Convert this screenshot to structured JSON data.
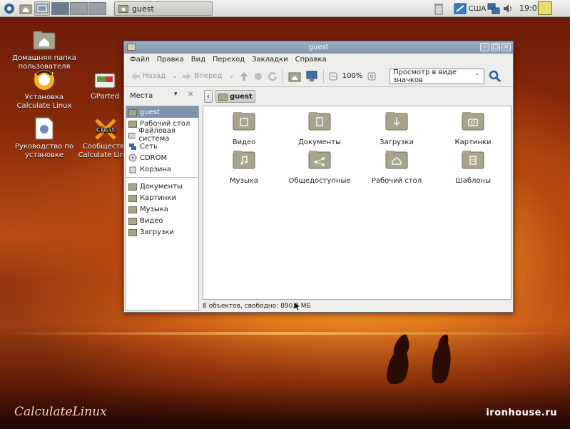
{
  "panel": {
    "task_title": "guest",
    "keyboard_layout": "США",
    "clock": "19:02"
  },
  "desktop": {
    "icons": [
      {
        "label": "Домашняя папка пользователя guest"
      },
      {
        "label": "Установка Calculate Linux"
      },
      {
        "label": "GParted"
      },
      {
        "label": "Руководство по установке"
      },
      {
        "label": "Сообщество Calculate Linux"
      }
    ],
    "chat_text": "chat",
    "logo": "CalculateLinux",
    "watermark": "ironhouse.ru"
  },
  "window": {
    "title": "guest",
    "menu": [
      "Файл",
      "Правка",
      "Вид",
      "Переход",
      "Закладки",
      "Справка"
    ],
    "toolbar": {
      "back": "Назад",
      "forward": "Вперед",
      "zoom": "100%",
      "view_mode": "Просмотр в виде значков"
    },
    "sidebar_header": "Места",
    "path_current": "guest",
    "places": [
      {
        "label": "guest",
        "selected": true
      },
      {
        "label": "Рабочий стол"
      },
      {
        "label": "Файловая система"
      },
      {
        "label": "Сеть"
      },
      {
        "label": "CDROM"
      },
      {
        "label": "Корзина"
      }
    ],
    "bookmarks": [
      {
        "label": "Документы"
      },
      {
        "label": "Картинки"
      },
      {
        "label": "Музыка"
      },
      {
        "label": "Видео"
      },
      {
        "label": "Загрузки"
      }
    ],
    "files": [
      {
        "label": "Видео",
        "icon": "video-folder-icon"
      },
      {
        "label": "Документы",
        "icon": "documents-folder-icon"
      },
      {
        "label": "Загрузки",
        "icon": "downloads-folder-icon"
      },
      {
        "label": "Картинки",
        "icon": "pictures-folder-icon"
      },
      {
        "label": "Музыка",
        "icon": "music-folder-icon"
      },
      {
        "label": "Общедоступные",
        "icon": "public-folder-icon"
      },
      {
        "label": "Рабочий стол",
        "icon": "desktop-folder-icon"
      },
      {
        "label": "Шаблоны",
        "icon": "templates-folder-icon"
      }
    ],
    "status": "8 объектов, свободно: 890.0 МБ"
  }
}
